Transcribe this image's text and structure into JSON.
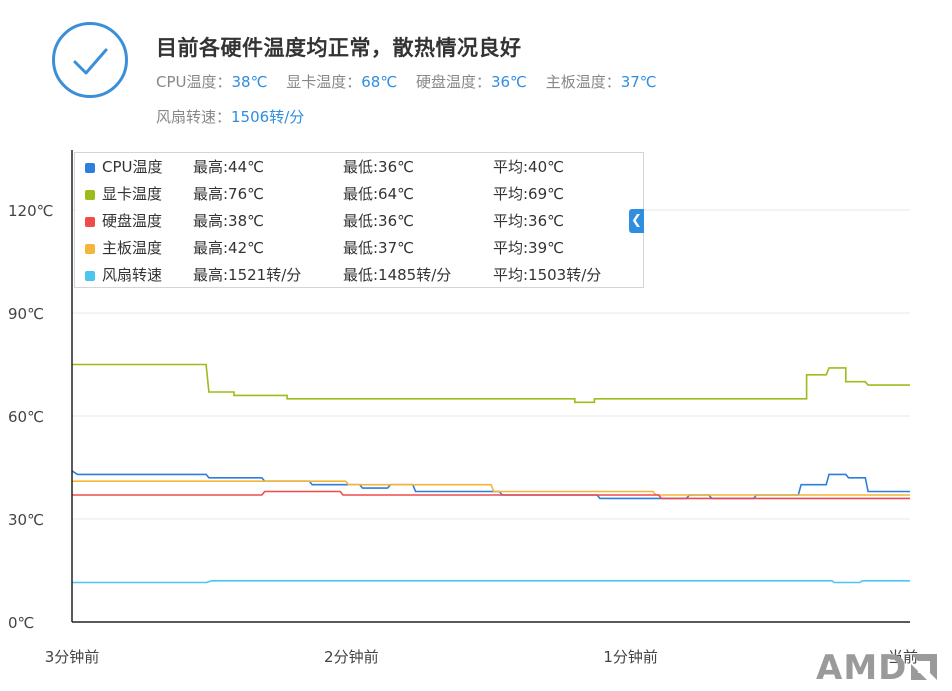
{
  "status": {
    "headline": "目前各硬件温度均正常，散热情况良好",
    "readings": [
      {
        "label": "CPU温度：",
        "value": "38℃"
      },
      {
        "label": "显卡温度：",
        "value": "68℃"
      },
      {
        "label": "硬盘温度：",
        "value": "36℃"
      },
      {
        "label": "主板温度：",
        "value": "37℃"
      }
    ],
    "fan": {
      "label": "风扇转速：",
      "value": "1506转/分"
    }
  },
  "legend": [
    {
      "name": "CPU温度",
      "max": "最高:44℃",
      "min": "最低:36℃",
      "avg": "平均:40℃",
      "color": "#2e7fdd"
    },
    {
      "name": "显卡温度",
      "max": "最高:76℃",
      "min": "最低:64℃",
      "avg": "平均:69℃",
      "color": "#9bbd1c"
    },
    {
      "name": "硬盘温度",
      "max": "最高:38℃",
      "min": "最低:36℃",
      "avg": "平均:36℃",
      "color": "#ef4b4b"
    },
    {
      "name": "主板温度",
      "max": "最高:42℃",
      "min": "最低:37℃",
      "avg": "平均:39℃",
      "color": "#f4b63a"
    },
    {
      "name": "风扇转速",
      "max": "最高:1521转/分",
      "min": "最低:1485转/分",
      "avg": "平均:1503转/分",
      "color": "#4cc6f0"
    }
  ],
  "logo_text": "AMD",
  "chart_data": {
    "type": "line",
    "ylim": [
      0,
      120
    ],
    "yticks": [
      0,
      30,
      60,
      90,
      120
    ],
    "ytick_labels": [
      "0℃",
      "30℃",
      "60℃",
      "90℃",
      "120℃"
    ],
    "xlim": [
      0,
      3
    ],
    "xticks": [
      0,
      1,
      2,
      3
    ],
    "xtick_labels": [
      "3分钟前",
      "2分钟前",
      "1分钟前",
      "当前"
    ],
    "grid": true,
    "legend_position": "top-left",
    "series": [
      {
        "name": "显卡温度",
        "color": "#9bbd1c",
        "points": [
          [
            0,
            75
          ],
          [
            0.48,
            75
          ],
          [
            0.49,
            67
          ],
          [
            0.58,
            67
          ],
          [
            0.58,
            66
          ],
          [
            0.77,
            66
          ],
          [
            0.77,
            65
          ],
          [
            1.8,
            65
          ],
          [
            1.8,
            64
          ],
          [
            1.87,
            64
          ],
          [
            1.87,
            65
          ],
          [
            2.63,
            65
          ],
          [
            2.63,
            72
          ],
          [
            2.7,
            72
          ],
          [
            2.71,
            74
          ],
          [
            2.77,
            74
          ],
          [
            2.77,
            70
          ],
          [
            2.84,
            70
          ],
          [
            2.85,
            69
          ],
          [
            3,
            69
          ]
        ]
      },
      {
        "name": "CPU温度",
        "color": "#2e7fdd",
        "points": [
          [
            0,
            44
          ],
          [
            0.02,
            43
          ],
          [
            0.48,
            43
          ],
          [
            0.49,
            42
          ],
          [
            0.68,
            42
          ],
          [
            0.69,
            41
          ],
          [
            0.85,
            41
          ],
          [
            0.86,
            40
          ],
          [
            1.03,
            40
          ],
          [
            1.04,
            39
          ],
          [
            1.13,
            39
          ],
          [
            1.14,
            40
          ],
          [
            1.22,
            40
          ],
          [
            1.23,
            38
          ],
          [
            1.53,
            38
          ],
          [
            1.54,
            37
          ],
          [
            1.88,
            37
          ],
          [
            1.89,
            36
          ],
          [
            2.2,
            36
          ],
          [
            2.21,
            37
          ],
          [
            2.28,
            37
          ],
          [
            2.29,
            36
          ],
          [
            2.44,
            36
          ],
          [
            2.45,
            37
          ],
          [
            2.6,
            37
          ],
          [
            2.61,
            40
          ],
          [
            2.7,
            40
          ],
          [
            2.71,
            43
          ],
          [
            2.77,
            43
          ],
          [
            2.78,
            42
          ],
          [
            2.84,
            42
          ],
          [
            2.85,
            38
          ],
          [
            3,
            38
          ]
        ]
      },
      {
        "name": "主板温度",
        "color": "#f4b63a",
        "points": [
          [
            0,
            41
          ],
          [
            0.98,
            41
          ],
          [
            0.99,
            40
          ],
          [
            1.5,
            40
          ],
          [
            1.51,
            38
          ],
          [
            2.08,
            38
          ],
          [
            2.09,
            37
          ],
          [
            3,
            37
          ]
        ]
      },
      {
        "name": "硬盘温度",
        "color": "#ef4b4b",
        "points": [
          [
            0,
            37
          ],
          [
            0.68,
            37
          ],
          [
            0.69,
            38
          ],
          [
            0.96,
            38
          ],
          [
            0.97,
            37
          ],
          [
            2.1,
            37
          ],
          [
            2.11,
            36
          ],
          [
            3,
            36
          ]
        ]
      },
      {
        "name": "风扇转速",
        "color": "#4cc6f0",
        "points": [
          [
            0,
            11.5
          ],
          [
            0.48,
            11.5
          ],
          [
            0.5,
            12
          ],
          [
            2.72,
            12
          ],
          [
            2.73,
            11.5
          ],
          [
            2.82,
            11.5
          ],
          [
            2.83,
            12
          ],
          [
            3,
            12
          ]
        ]
      }
    ]
  }
}
